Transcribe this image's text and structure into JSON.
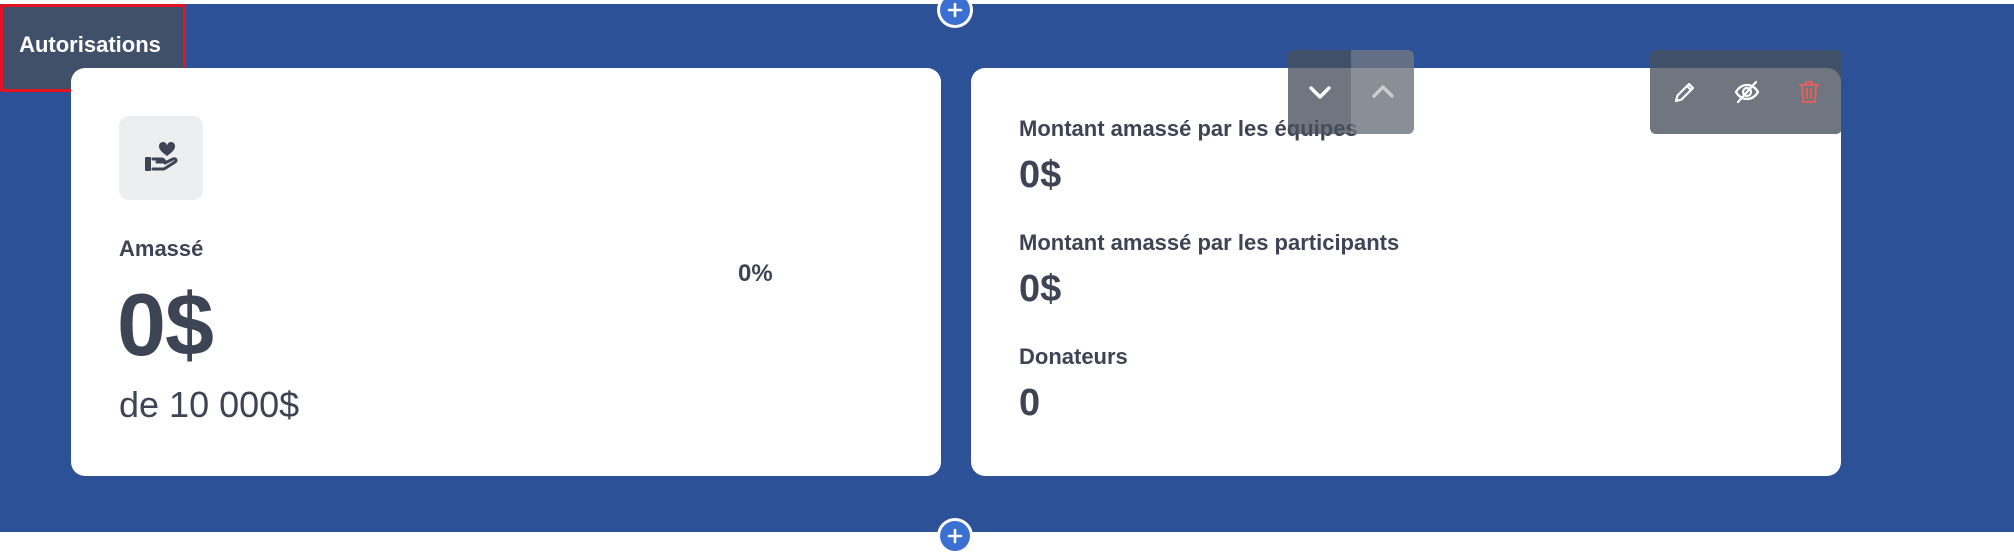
{
  "left_card": {
    "icon": "hand-heart-icon",
    "raised_label": "Amassé",
    "raised_value": "0$",
    "goal_text": "de 10 000$",
    "percent": "0%"
  },
  "right_card": {
    "teams_label": "Montant amassé par les équipes",
    "teams_value": "0$",
    "participants_label": "Montant amassé par les participants",
    "participants_value": "0$",
    "donors_label": "Donateurs",
    "donors_value": "0"
  },
  "toolbar": {
    "permissions_label": "Autorisations",
    "icons": [
      "chevron-down-icon",
      "chevron-up-icon",
      "pencil-icon",
      "eye-off-icon",
      "trash-icon"
    ]
  },
  "colors": {
    "background": "#2c5196",
    "card": "#ffffff",
    "text": "#3d4454",
    "highlight_border": "#e3131f",
    "delete_icon": "#e0605a"
  }
}
